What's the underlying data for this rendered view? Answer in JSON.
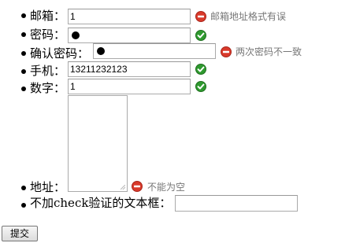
{
  "form": {
    "fields": [
      {
        "label": "邮箱：",
        "value": "1",
        "status": "error",
        "message": "邮箱地址格式有误"
      },
      {
        "label": "密码：",
        "value": "●",
        "status": "ok",
        "message": ""
      },
      {
        "label": "确认密码：",
        "value": "●",
        "status": "error",
        "message": "两次密码不一致"
      },
      {
        "label": "手机：",
        "value": "13211232123",
        "status": "ok",
        "message": ""
      },
      {
        "label": "数字：",
        "value": "1",
        "status": "ok",
        "message": ""
      },
      {
        "label": "地址：",
        "value": "",
        "status": "error",
        "message": "不能为空"
      },
      {
        "label": "不加check验证的文本框：",
        "value": "",
        "status": "none",
        "message": ""
      }
    ],
    "submit_label": "提交"
  },
  "colors": {
    "error_icon": "#d93a2b",
    "ok_icon": "#2f9a2f",
    "message_text": "#777777"
  },
  "icons": {
    "error": "error-icon",
    "ok": "check-icon"
  }
}
